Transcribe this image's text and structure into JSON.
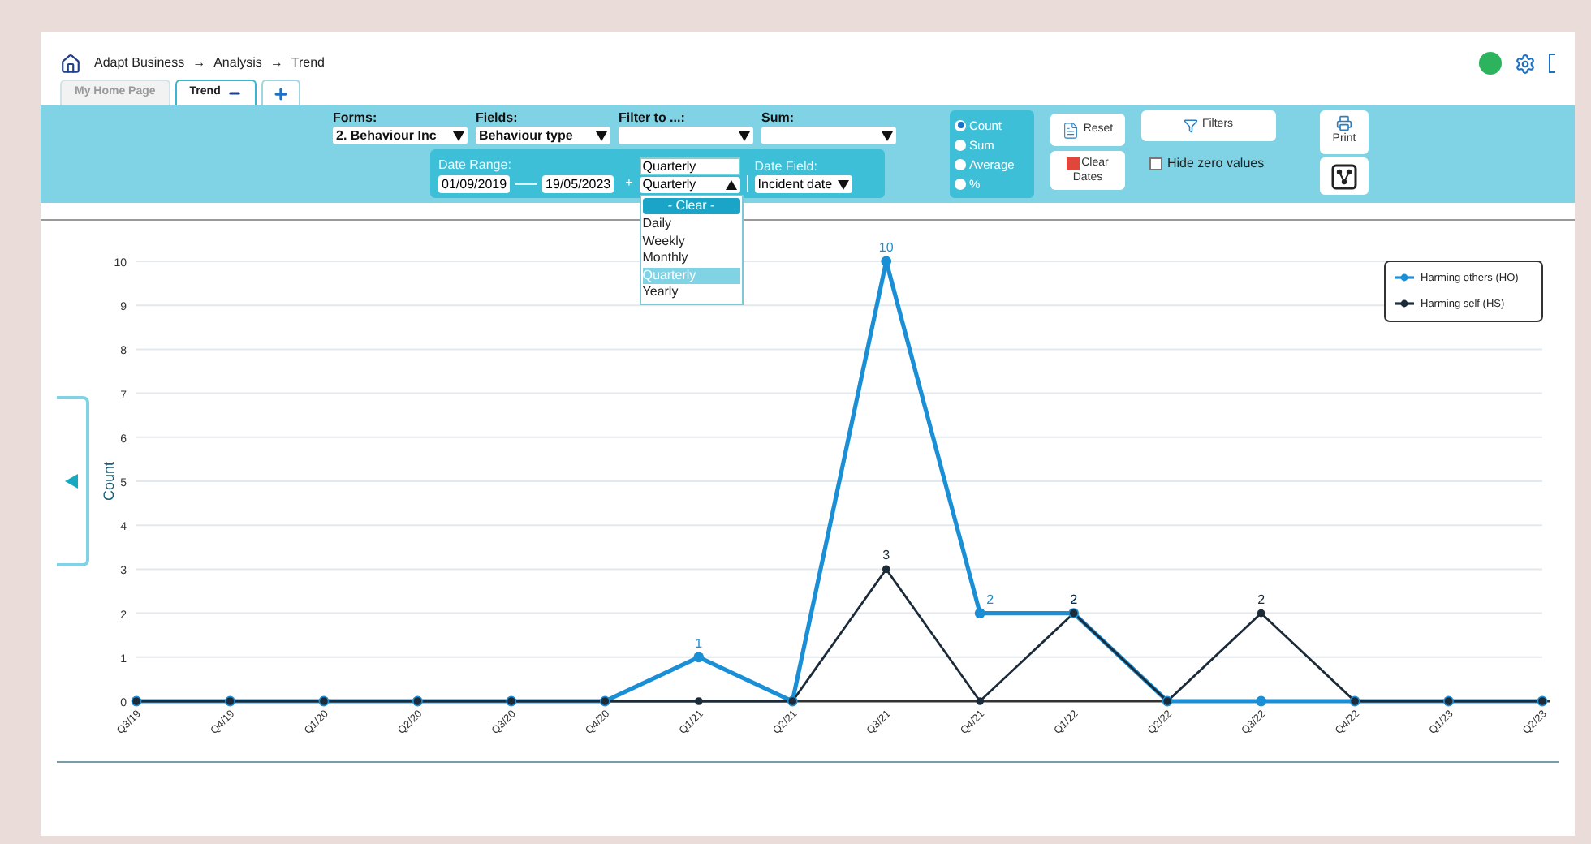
{
  "breadcrumb": {
    "items": [
      "Adapt Business",
      "Analysis",
      "Trend"
    ],
    "separator": "→"
  },
  "tabs": [
    {
      "label": "My Home Page",
      "selected": false
    },
    {
      "label": "Trend",
      "selected": true
    }
  ],
  "status_dot": {
    "color": "#2db35d"
  },
  "selectors": [
    {
      "label": "Forms:",
      "value": "2. Behaviour Inc"
    },
    {
      "label": "Fields:",
      "value": "Behaviour type"
    },
    {
      "label": "Filter to ...:"
    },
    {
      "label": "Sum:"
    }
  ],
  "date_range": {
    "label": "Date Range:",
    "from": "01/09/2019",
    "to": "19/05/2023",
    "plus": "+",
    "period_input": "Quarterly",
    "period_select": "Quarterly",
    "expanded": true,
    "clear": "- Clear -",
    "options": [
      {
        "label": "Daily",
        "selected": false
      },
      {
        "label": "Weekly",
        "selected": false
      },
      {
        "label": "Monthly",
        "selected": false
      },
      {
        "label": "Quarterly",
        "selected": true
      },
      {
        "label": "Yearly",
        "selected": false
      }
    ]
  },
  "date_field": {
    "label": "Date Field:",
    "value": "Incident date"
  },
  "aggregate": [
    {
      "label": "Count",
      "selected": true
    },
    {
      "label": "Sum",
      "selected": false
    },
    {
      "label": "Average",
      "selected": false
    },
    {
      "label": "%",
      "selected": false
    }
  ],
  "buttons": {
    "reset": "Reset",
    "clear_dates": [
      "Clear",
      "Dates"
    ],
    "filters": "Filters",
    "print": "Print"
  },
  "hide_zero": {
    "label": "Hide zero values",
    "checked": false
  },
  "chart": {
    "chart_data": {
      "type": "line",
      "ylabel": "Count",
      "categories": [
        "Q3/19",
        "Q4/19",
        "Q1/20",
        "Q2/20",
        "Q3/20",
        "Q4/20",
        "Q1/21",
        "Q2/21",
        "Q3/21",
        "Q4/21",
        "Q1/22",
        "Q2/22",
        "Q3/22",
        "Q4/22",
        "Q1/23",
        "Q2/23"
      ],
      "series": [
        {
          "name": "Harming others (HO)",
          "color": "#1a8fd6",
          "marker": "circle",
          "values": [
            0,
            0,
            0,
            0,
            0,
            0,
            1,
            0,
            10,
            2,
            2,
            0,
            0,
            0,
            0,
            0
          ],
          "value_labels": [
            null,
            null,
            null,
            null,
            null,
            null,
            "1",
            null,
            "10",
            "2",
            "2",
            null,
            null,
            null,
            null,
            null
          ]
        },
        {
          "name": "Harming self (HS)",
          "color": "#1c2b3a",
          "marker": "circle",
          "values": [
            0,
            0,
            0,
            0,
            0,
            0,
            0,
            0,
            3,
            0,
            2,
            0,
            2,
            0,
            0,
            0
          ],
          "value_labels": [
            null,
            null,
            null,
            null,
            null,
            null,
            null,
            null,
            "3",
            null,
            "2",
            null,
            "2",
            null,
            null,
            null
          ]
        }
      ],
      "ylim": [
        0,
        10
      ],
      "yticks": [
        0,
        1,
        2,
        3,
        4,
        5,
        6,
        7,
        8,
        9,
        10
      ],
      "grid": true,
      "legend": "upper right"
    }
  }
}
